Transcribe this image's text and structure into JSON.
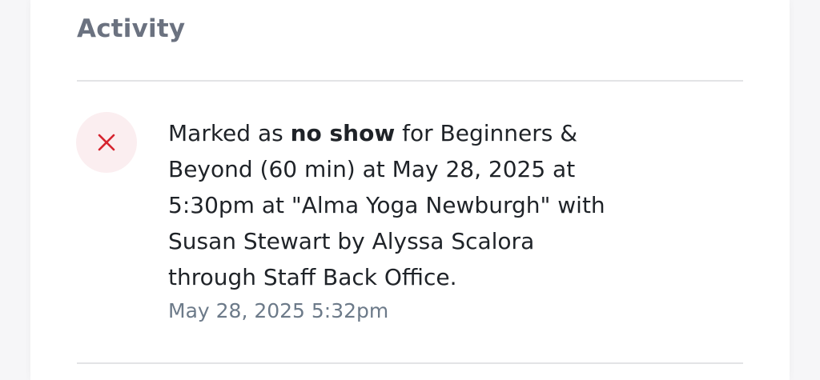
{
  "section": {
    "title": "Activity"
  },
  "activity": {
    "status_icon": "close-x-icon",
    "status_color": "#d6242f",
    "status_bg": "#fbeef0",
    "message_prefix": "Marked as ",
    "message_highlight": "no show",
    "message_suffix": " for Beginners & Beyond (60 min) at May 28, 2025 at 5:30pm at \"Alma Yoga Newburgh\" with Susan Stewart by Alyssa Scalora through Staff Back Office.",
    "timestamp": "May 28, 2025 5:32pm"
  }
}
